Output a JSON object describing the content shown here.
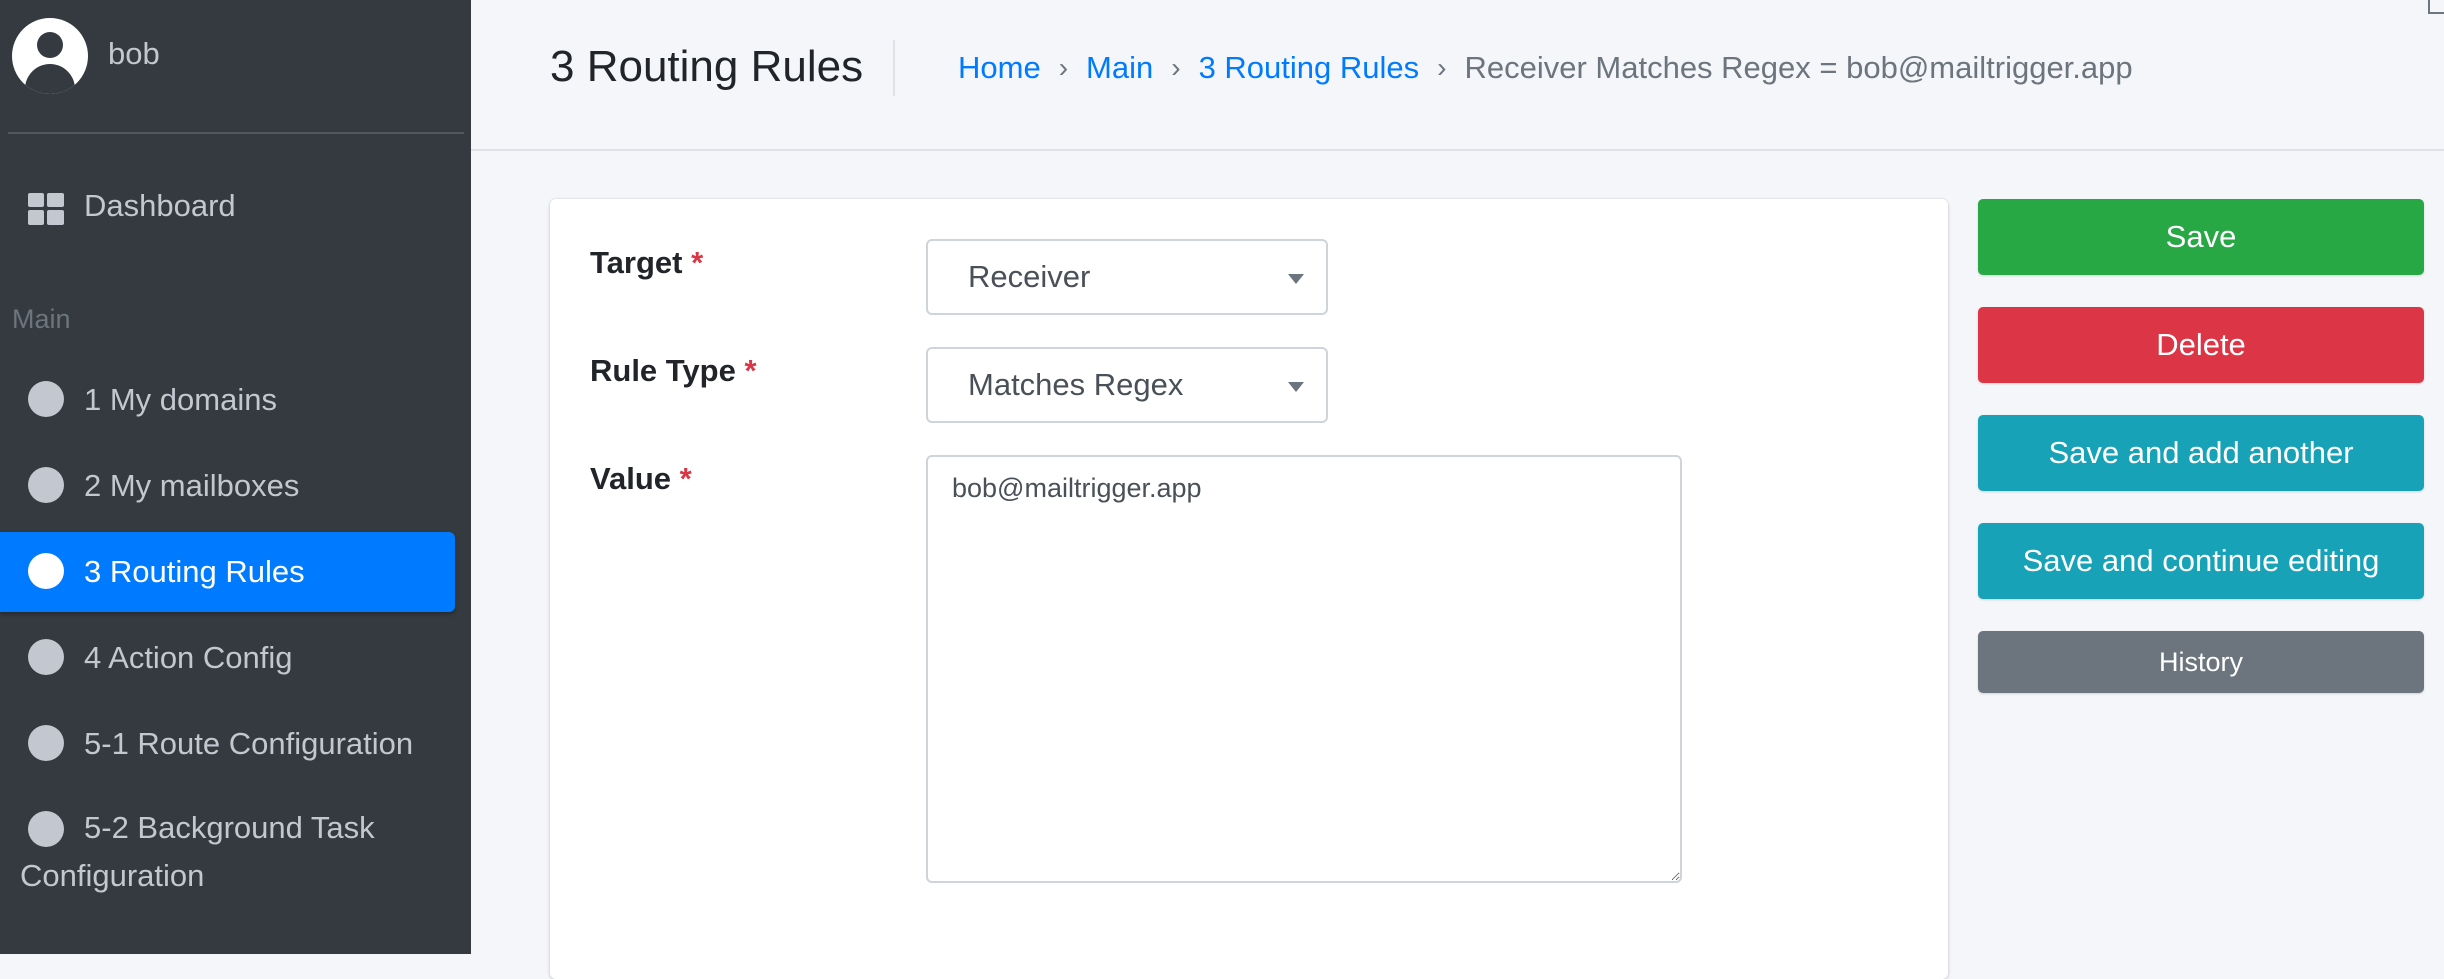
{
  "user": {
    "name": "bob",
    "avatar_icon": "user-circle-icon"
  },
  "sidebar": {
    "dashboard": {
      "label": "Dashboard",
      "icon": "dashboard-grid-icon"
    },
    "section_header": "Main",
    "items": [
      {
        "label": "1 My domains",
        "icon": "circle-icon",
        "active": false
      },
      {
        "label": "2 My mailboxes",
        "icon": "circle-icon",
        "active": false
      },
      {
        "label": "3 Routing Rules",
        "icon": "circle-icon",
        "active": true
      },
      {
        "label": "4 Action Config",
        "icon": "circle-icon",
        "active": false
      },
      {
        "label": "5-1 Route Configuration",
        "icon": "circle-icon",
        "active": false
      },
      {
        "label_line1": "5-2 Background Task",
        "label_line2": "Configuration",
        "icon": "circle-icon",
        "active": false
      }
    ],
    "colors": {
      "background": "#343a40",
      "active": "#007bff",
      "text": "#c2c7d0"
    }
  },
  "header": {
    "title": "3 Routing Rules",
    "breadcrumb": {
      "items": [
        "Home",
        "Main",
        "3 Routing Rules"
      ],
      "separator": "›",
      "current": "Receiver Matches Regex = bob@mailtrigger.app"
    }
  },
  "form": {
    "required_marker": "*",
    "target": {
      "label": "Target",
      "value": "Receiver"
    },
    "rule_type": {
      "label": "Rule Type",
      "value": "Matches Regex"
    },
    "value": {
      "label": "Value",
      "value": "bob@mailtrigger.app"
    }
  },
  "actions": {
    "save": {
      "label": "Save",
      "color": "#28a745"
    },
    "delete": {
      "label": "Delete",
      "color": "#dc3545"
    },
    "save_add_another": {
      "label": "Save and add another",
      "color": "#17a2b8"
    },
    "save_continue": {
      "label": "Save and continue editing",
      "color": "#17a2b8"
    },
    "history": {
      "label": "History",
      "color": "#6c757d"
    }
  }
}
